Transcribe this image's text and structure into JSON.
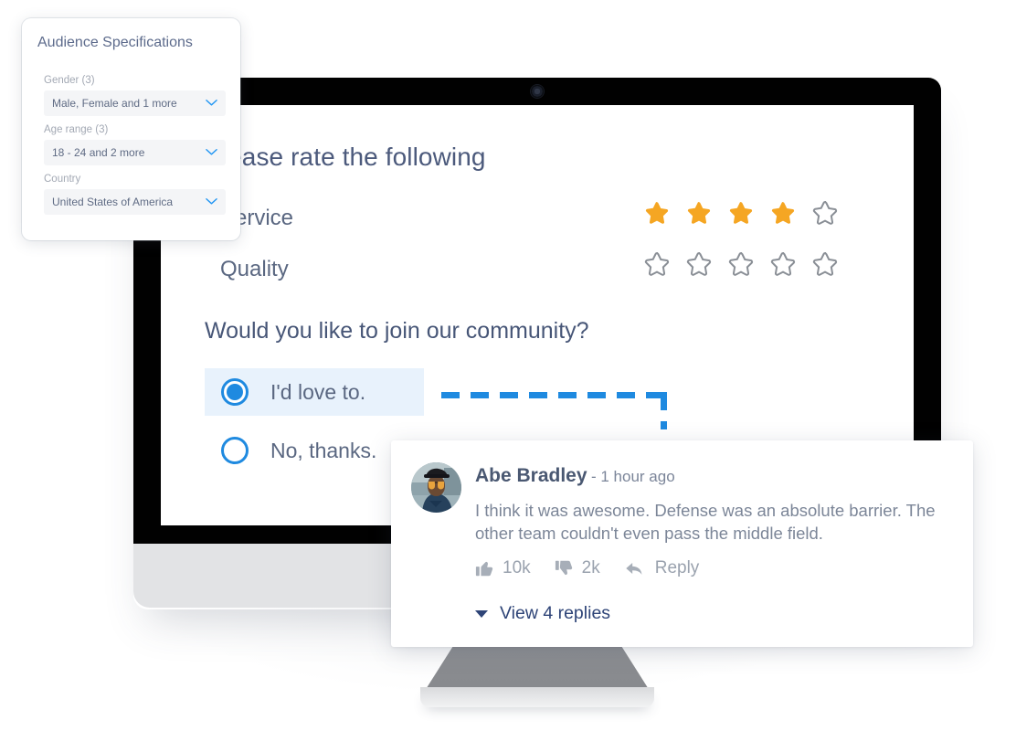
{
  "audience_popover": {
    "title": "Audience Specifications",
    "fields": [
      {
        "label": "Gender (3)",
        "value": "Male, Female and 1 more",
        "icon": "chevron-down-icon"
      },
      {
        "label": "Age range (3)",
        "value": "18 - 24 and 2 more",
        "icon": "chevron-down-icon"
      },
      {
        "label": "Country",
        "value": "United States of America",
        "icon": "chevron-down-icon"
      }
    ]
  },
  "survey": {
    "title": "Please rate the following",
    "ratings": [
      {
        "label": "Service",
        "value": 4,
        "max": 5
      },
      {
        "label": "Quality",
        "value": 0,
        "max": 5
      }
    ],
    "question": "Would you like to join our community?",
    "options": [
      {
        "label": "I'd love to.",
        "selected": true
      },
      {
        "label": "No, thanks.",
        "selected": false
      }
    ]
  },
  "comment": {
    "author": "Abe Bradley",
    "timestamp": "- 1 hour ago",
    "body": "I think it was awesome. Defense was an absolute barrier. The other team couldn't even pass the middle field.",
    "likes": "10k",
    "dislikes": "2k",
    "reply_label": "Reply",
    "view_replies_label": "View 4 replies",
    "avatar_alt": "user-avatar-photo"
  },
  "colors": {
    "star_filled": "#F5A623",
    "star_empty": "#8A8F96",
    "accent_blue": "#1F8AE0",
    "selected_row_bg": "#E8F2FC",
    "link_navy": "#2E4477",
    "heading": "#4C5A7C",
    "body_gray": "#7C8698",
    "bezel": "#010101",
    "chin": "#E2E3E5"
  }
}
